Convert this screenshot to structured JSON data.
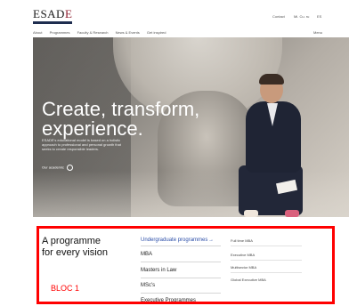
{
  "header": {
    "logo": {
      "prefix": "ESAD",
      "accent": "E"
    },
    "links": [
      "Contact",
      "Mi. Cu. ru",
      "ES"
    ],
    "nav": [
      "About",
      "Programmes",
      "Faculty & Research",
      "News & Events",
      "Get inspired"
    ],
    "menu_label": "Menu"
  },
  "hero": {
    "title_line1": "Create, transform,",
    "title_line2": "experience.",
    "description": "ESADE's educational model is based on a holistic approach to professional and personal growth that seeks to create responsible leaders.",
    "cta_label": "Our academic"
  },
  "programmes": {
    "heading": "A programme\nfor every vision",
    "column1": [
      "Undergraduate programmes",
      "MBA",
      "Masters in Law",
      "MSc's",
      "Executive Programmes"
    ],
    "column1_arrow": "→",
    "column2": [
      "Full time MBA",
      "Executive MBA",
      "Multisector MBA",
      "Global Executive MBA"
    ]
  },
  "annotation": {
    "label": "BLOC 1",
    "color": "#ff0000"
  },
  "colors": {
    "accent_blue": "#2b4ea8",
    "brand_red": "#8b1a2b",
    "brand_navy": "#1e2d4f"
  }
}
